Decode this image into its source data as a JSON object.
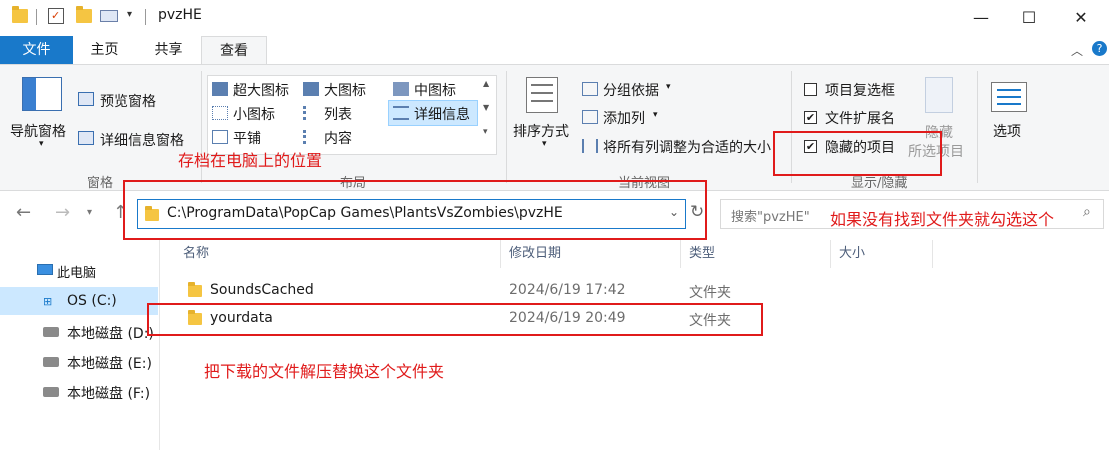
{
  "window": {
    "title": "pvzHE",
    "minimize_glyph": "—",
    "maximize_glyph": "☐",
    "close_glyph": "✕"
  },
  "ribbon_tabs": {
    "file": "文件",
    "home": "主页",
    "share": "共享",
    "view": "查看"
  },
  "ribbon": {
    "panes": {
      "nav_pane": "导航窗格",
      "preview_pane": "预览窗格",
      "details_pane": "详细信息窗格",
      "group_label": "窗格"
    },
    "layout": {
      "extra_large_icons": "超大图标",
      "large_icons": "大图标",
      "medium_icons": "中图标",
      "small_icons": "小图标",
      "list": "列表",
      "details": "详细信息",
      "tiles": "平铺",
      "content": "内容",
      "group_label": "布局"
    },
    "current_view": {
      "sort_by": "排序方式",
      "group_by": "分组依据",
      "add_columns": "添加列",
      "size_all_columns": "将所有列调整为合适的大小",
      "group_label": "当前视图"
    },
    "show_hide": {
      "item_checkboxes": "项目复选框",
      "file_extensions": "文件扩展名",
      "hidden_items": "隐藏的项目",
      "hide_selected_1": "隐藏",
      "hide_selected_2": "所选项目",
      "group_label": "显示/隐藏",
      "item_checkboxes_checked": false,
      "file_extensions_checked": true,
      "hidden_items_checked": true
    },
    "options": "选项"
  },
  "address": {
    "path": "C:\\ProgramData\\PopCap Games\\PlantsVsZombies\\pvzHE",
    "search_placeholder": "搜索\"pvzHE\""
  },
  "sidebar": {
    "items": [
      {
        "label": "此电脑"
      },
      {
        "label": "OS (C:)"
      },
      {
        "label": "本地磁盘 (D:)"
      },
      {
        "label": "本地磁盘 (E:)"
      },
      {
        "label": "本地磁盘 (F:)"
      }
    ]
  },
  "columns": {
    "name": "名称",
    "date": "修改日期",
    "type": "类型",
    "size": "大小"
  },
  "files": [
    {
      "name": "SoundsCached",
      "date": "2024/6/19 17:42",
      "type": "文件夹"
    },
    {
      "name": "yourdata",
      "date": "2024/6/19 20:49",
      "type": "文件夹"
    }
  ],
  "annotations": {
    "save_location": "存档在电脑上的位置",
    "check_hidden": "如果没有找到文件夹就勾选这个",
    "replace_folder": "把下载的文件解压替换这个文件夹"
  },
  "colors": {
    "accent": "#1979ca",
    "annotation_red": "#e01b1b",
    "selection": "#cce8ff",
    "folder": "#f5c542"
  }
}
